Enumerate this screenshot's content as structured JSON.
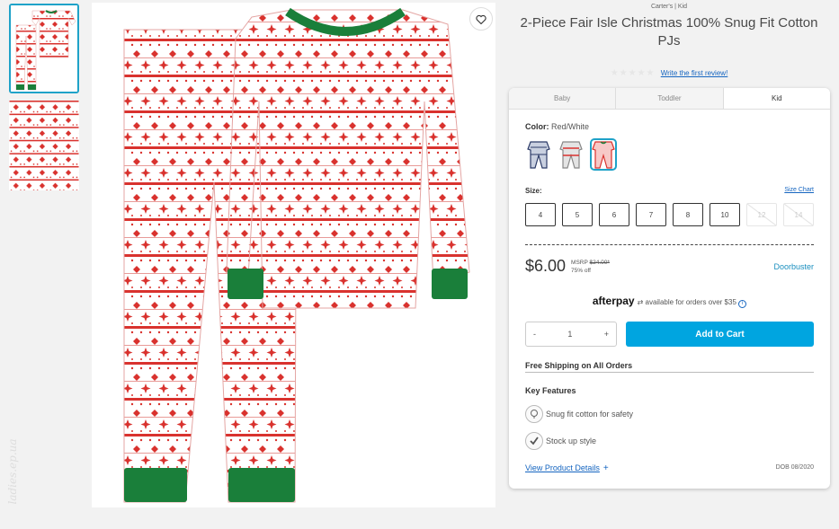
{
  "gallery": {
    "thumbnails": [
      {
        "alt": "pajama-set-front"
      },
      {
        "alt": "fabric-pattern"
      }
    ],
    "watermark": "ladies.ep.ua"
  },
  "product": {
    "brand_line": "Carter's | Kid",
    "title": "2-Piece Fair Isle Christmas 100% Snug Fit Cotton PJs",
    "stars": "★★★★★",
    "review_link": "Write the first review!"
  },
  "tabs": [
    "Baby",
    "Toddler",
    "Kid"
  ],
  "selected_tab": "Kid",
  "color": {
    "label": "Color:",
    "value": "Red/White",
    "swatches": [
      "navy-print",
      "grey-stripe",
      "red-white"
    ]
  },
  "size": {
    "label": "Size:",
    "chart_link": "Size Chart",
    "options": [
      {
        "label": "4",
        "available": true
      },
      {
        "label": "5",
        "available": true
      },
      {
        "label": "6",
        "available": true
      },
      {
        "label": "7",
        "available": true
      },
      {
        "label": "8",
        "available": true
      },
      {
        "label": "10",
        "available": true
      },
      {
        "label": "12",
        "available": false
      },
      {
        "label": "14",
        "available": false
      }
    ]
  },
  "pricing": {
    "price": "$6.00",
    "msrp_label": "MSRP",
    "msrp_value": "$24.00*",
    "discount": "75% off",
    "promo": "Doorbuster"
  },
  "afterpay": {
    "brand": "afterpay",
    "text": "available for orders over $35",
    "info_icon": "i"
  },
  "cart": {
    "minus": "-",
    "quantity": "1",
    "plus": "+",
    "add_label": "Add to Cart"
  },
  "shipping": "Free Shipping on All Orders",
  "features": {
    "title": "Key Features",
    "items": [
      "Snug fit cotton for safety",
      "Stock up style"
    ]
  },
  "details": {
    "link": "View Product Details",
    "plus": "+",
    "dob": "DOB 08/2020"
  },
  "colors": {
    "accent": "#00a5e0",
    "link": "#1565c0",
    "selected_border": "#1fa2c8",
    "print_red": "#d9322e",
    "cuff_green": "#1a7f3a"
  }
}
